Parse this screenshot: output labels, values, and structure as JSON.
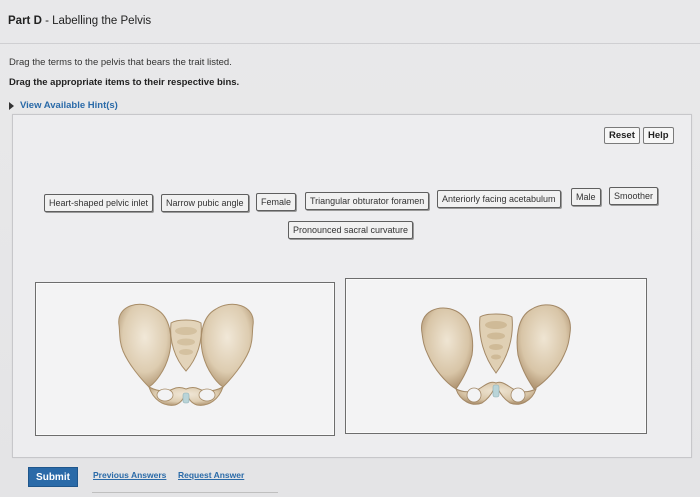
{
  "header": {
    "part_label": "Part D",
    "part_title": " - Labelling the Pelvis"
  },
  "instructions": {
    "line1": "Drag the terms to the pelvis that bears the trait listed.",
    "line2": "Drag the appropriate items to their respective bins.",
    "hints_link": "View Available Hint(s)"
  },
  "toolbar": {
    "reset_label": "Reset",
    "help_label": "Help"
  },
  "terms": [
    "Heart-shaped pelvic inlet",
    "Narrow pubic angle",
    "Female",
    "Triangular obturator foramen",
    "Anteriorly facing acetabulum",
    "Male",
    "Smoother",
    "Pronounced sacral curvature"
  ],
  "footer": {
    "submit_label": "Submit",
    "previous_answers_label": "Previous Answers",
    "request_answer_label": "Request Answer"
  },
  "colors": {
    "accent": "#2a6aa8",
    "bone": "#e6d9c3",
    "bone_shadow": "#b89f7d"
  }
}
